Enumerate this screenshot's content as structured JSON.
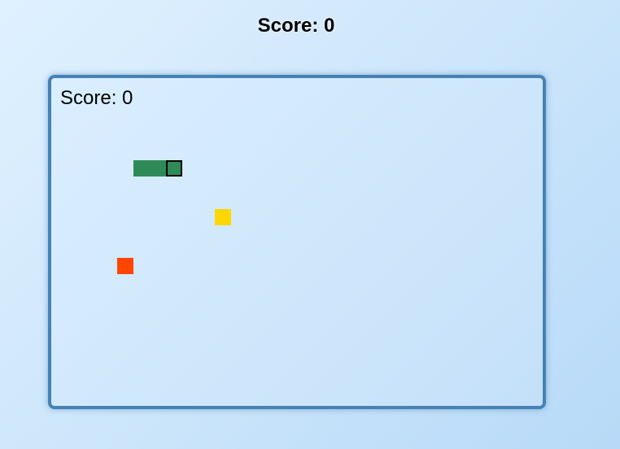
{
  "header": {
    "score_text": "Score: 0"
  },
  "board": {
    "score_text": "Score: 0",
    "border_color": "#4682b4",
    "background_color": "#d4eafd"
  },
  "snake": {
    "color": "#2e8b57",
    "head_outline_color": "#000000",
    "length": 3,
    "direction": "right"
  },
  "food": {
    "color": "#ffd700"
  },
  "bonus_item": {
    "color": "#ff4500"
  }
}
